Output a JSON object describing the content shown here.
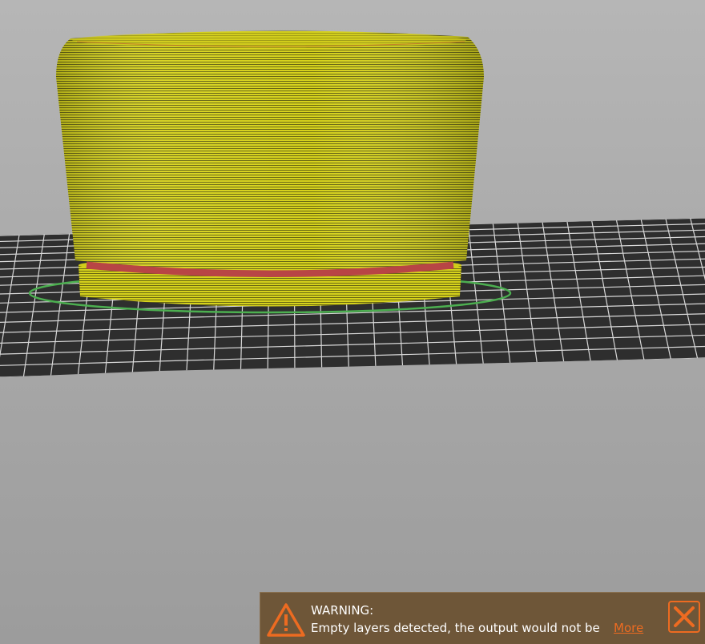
{
  "viewport": {
    "bed_color": "#2e2e2e",
    "bed_grid_color": "#d8d8d8",
    "object_color": "#d8d41e",
    "object_line_color": "#5a5a10",
    "skirt_color": "#4caf50",
    "support_band_color": "#c04040"
  },
  "notification": {
    "title": "WARNING:",
    "message": "Empty layers detected, the output would not be",
    "more_link": "More",
    "accent_color": "#ed6b21",
    "icon": "warning-triangle-icon",
    "close_icon": "close-icon"
  }
}
